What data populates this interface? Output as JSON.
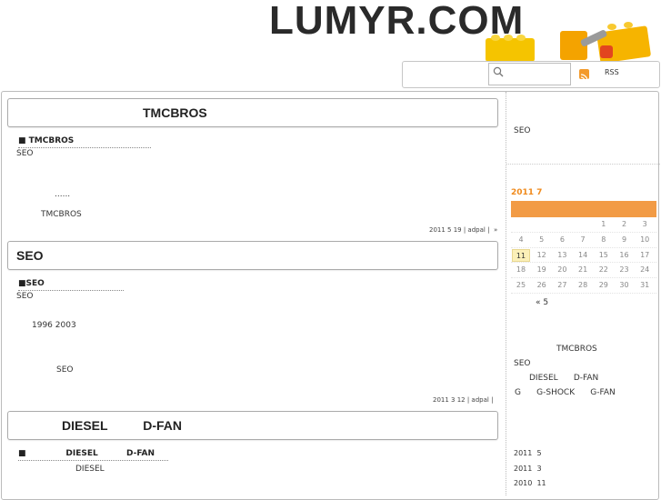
{
  "site": {
    "title": "LUMYR.COM"
  },
  "header": {
    "search_placeholder": "",
    "rss_label": "RSS"
  },
  "posts": [
    {
      "title": "TMCBROS",
      "subhead": "■                         TMCBROS",
      "lines": [
        "SEO",
        "......",
        "TMCBROS"
      ],
      "meta": "2011  5  19   | adpal |",
      "more": "»"
    },
    {
      "title": "SEO",
      "subhead": "■SEO",
      "lines": [
        "SEO",
        "1996  2003",
        "SEO"
      ],
      "meta": "2011  3  12   | adpal |"
    },
    {
      "title": "DIESEL          D-FAN",
      "subhead": "■              DIESEL          D-FAN",
      "lines": [
        "DIESEL"
      ]
    }
  ],
  "sidebar": {
    "top_text": "SEO",
    "calendar": {
      "title": "2011  7",
      "days": [
        "1",
        "2",
        "3",
        "4",
        "5",
        "6",
        "7",
        "8",
        "9",
        "10",
        "11",
        "12",
        "13",
        "14",
        "15",
        "16",
        "17",
        "18",
        "19",
        "20",
        "21",
        "22",
        "23",
        "24",
        "25",
        "26",
        "27",
        "28",
        "29",
        "30",
        "31"
      ],
      "today": "11",
      "prev_link": "« 5"
    },
    "categories": [
      "TMCBROS",
      "SEO",
      "DIESEL      D-FAN",
      "G      G-SHOCK      G-FAN"
    ],
    "archives": [
      "2011  5",
      "2011  3",
      "2010  11"
    ]
  }
}
